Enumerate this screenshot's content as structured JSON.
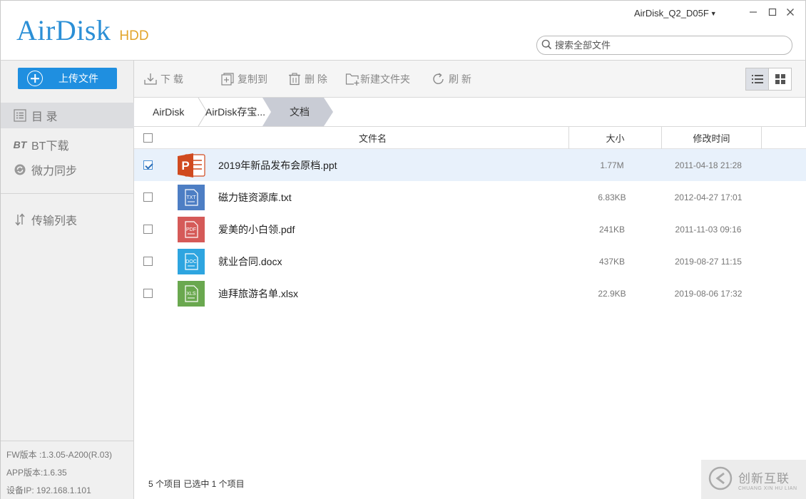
{
  "app": {
    "logo_main": "AirDisk",
    "logo_sub": "HDD",
    "device_name": "AirDisk_Q2_D05F",
    "colors": {
      "accent": "#1f8fe0",
      "logo_blue": "#2b8fd6",
      "logo_orange": "#e2a42a",
      "selected_row": "#e8f1fb"
    }
  },
  "window": {
    "minimize_icon": "minimize-icon",
    "maximize_icon": "maximize-icon",
    "close_icon": "close-icon"
  },
  "search": {
    "placeholder": "搜索全部文件",
    "icon": "search-icon"
  },
  "sidebar": {
    "upload_label": "上传文件",
    "items": [
      {
        "label": "目 录",
        "icon": "list-icon",
        "active": true
      },
      {
        "label": "BT下载",
        "icon": "bt-icon",
        "icon_text": "BT"
      },
      {
        "label": "微力同步",
        "icon": "sync-icon"
      },
      {
        "label": "传输列表",
        "icon": "transfer-icon"
      }
    ],
    "fw_version": "FW版本 :1.3.05-A200(R.03)",
    "app_version": "APP版本:1.6.35",
    "device_ip": "设备IP: 192.168.1.101"
  },
  "toolbar": {
    "download": "下 载",
    "copy_to": "复制到",
    "delete": "删 除",
    "new_folder": "新建文件夹",
    "refresh": "刷 新",
    "view_list_icon": "list-view-icon",
    "view_grid_icon": "grid-view-icon"
  },
  "breadcrumb": [
    "AirDisk",
    "AirDisk存宝...",
    "文档"
  ],
  "table": {
    "columns": {
      "name": "文件名",
      "size": "大小",
      "modified": "修改时间"
    },
    "rows": [
      {
        "name": "2019年新品发布会原档.ppt",
        "size": "1.77M",
        "modified": "2011-04-18 21:28",
        "type": "ppt",
        "checked": true
      },
      {
        "name": "磁力链资源库.txt",
        "size": "6.83KB",
        "modified": "2012-04-27 17:01",
        "type": "txt",
        "checked": false
      },
      {
        "name": "爱美的小白领.pdf",
        "size": "241KB",
        "modified": "2011-11-03 09:16",
        "type": "pdf",
        "checked": false
      },
      {
        "name": "就业合同.docx",
        "size": "437KB",
        "modified": "2019-08-27 11:15",
        "type": "doc",
        "checked": false
      },
      {
        "name": "迪拜旅游名单.xlsx",
        "size": "22.9KB",
        "modified": "2019-08-06 17:32",
        "type": "xls",
        "checked": false
      }
    ],
    "icon_labels": {
      "txt": "TXT",
      "pdf": "PDF",
      "doc": "DOC",
      "xls": "XLS",
      "ppt": "P"
    }
  },
  "status": {
    "text": "5 个项目 已选中 1 个项目"
  },
  "watermark": {
    "main": "创新互联",
    "sub": "CHUANG XIN HU LIAN"
  }
}
